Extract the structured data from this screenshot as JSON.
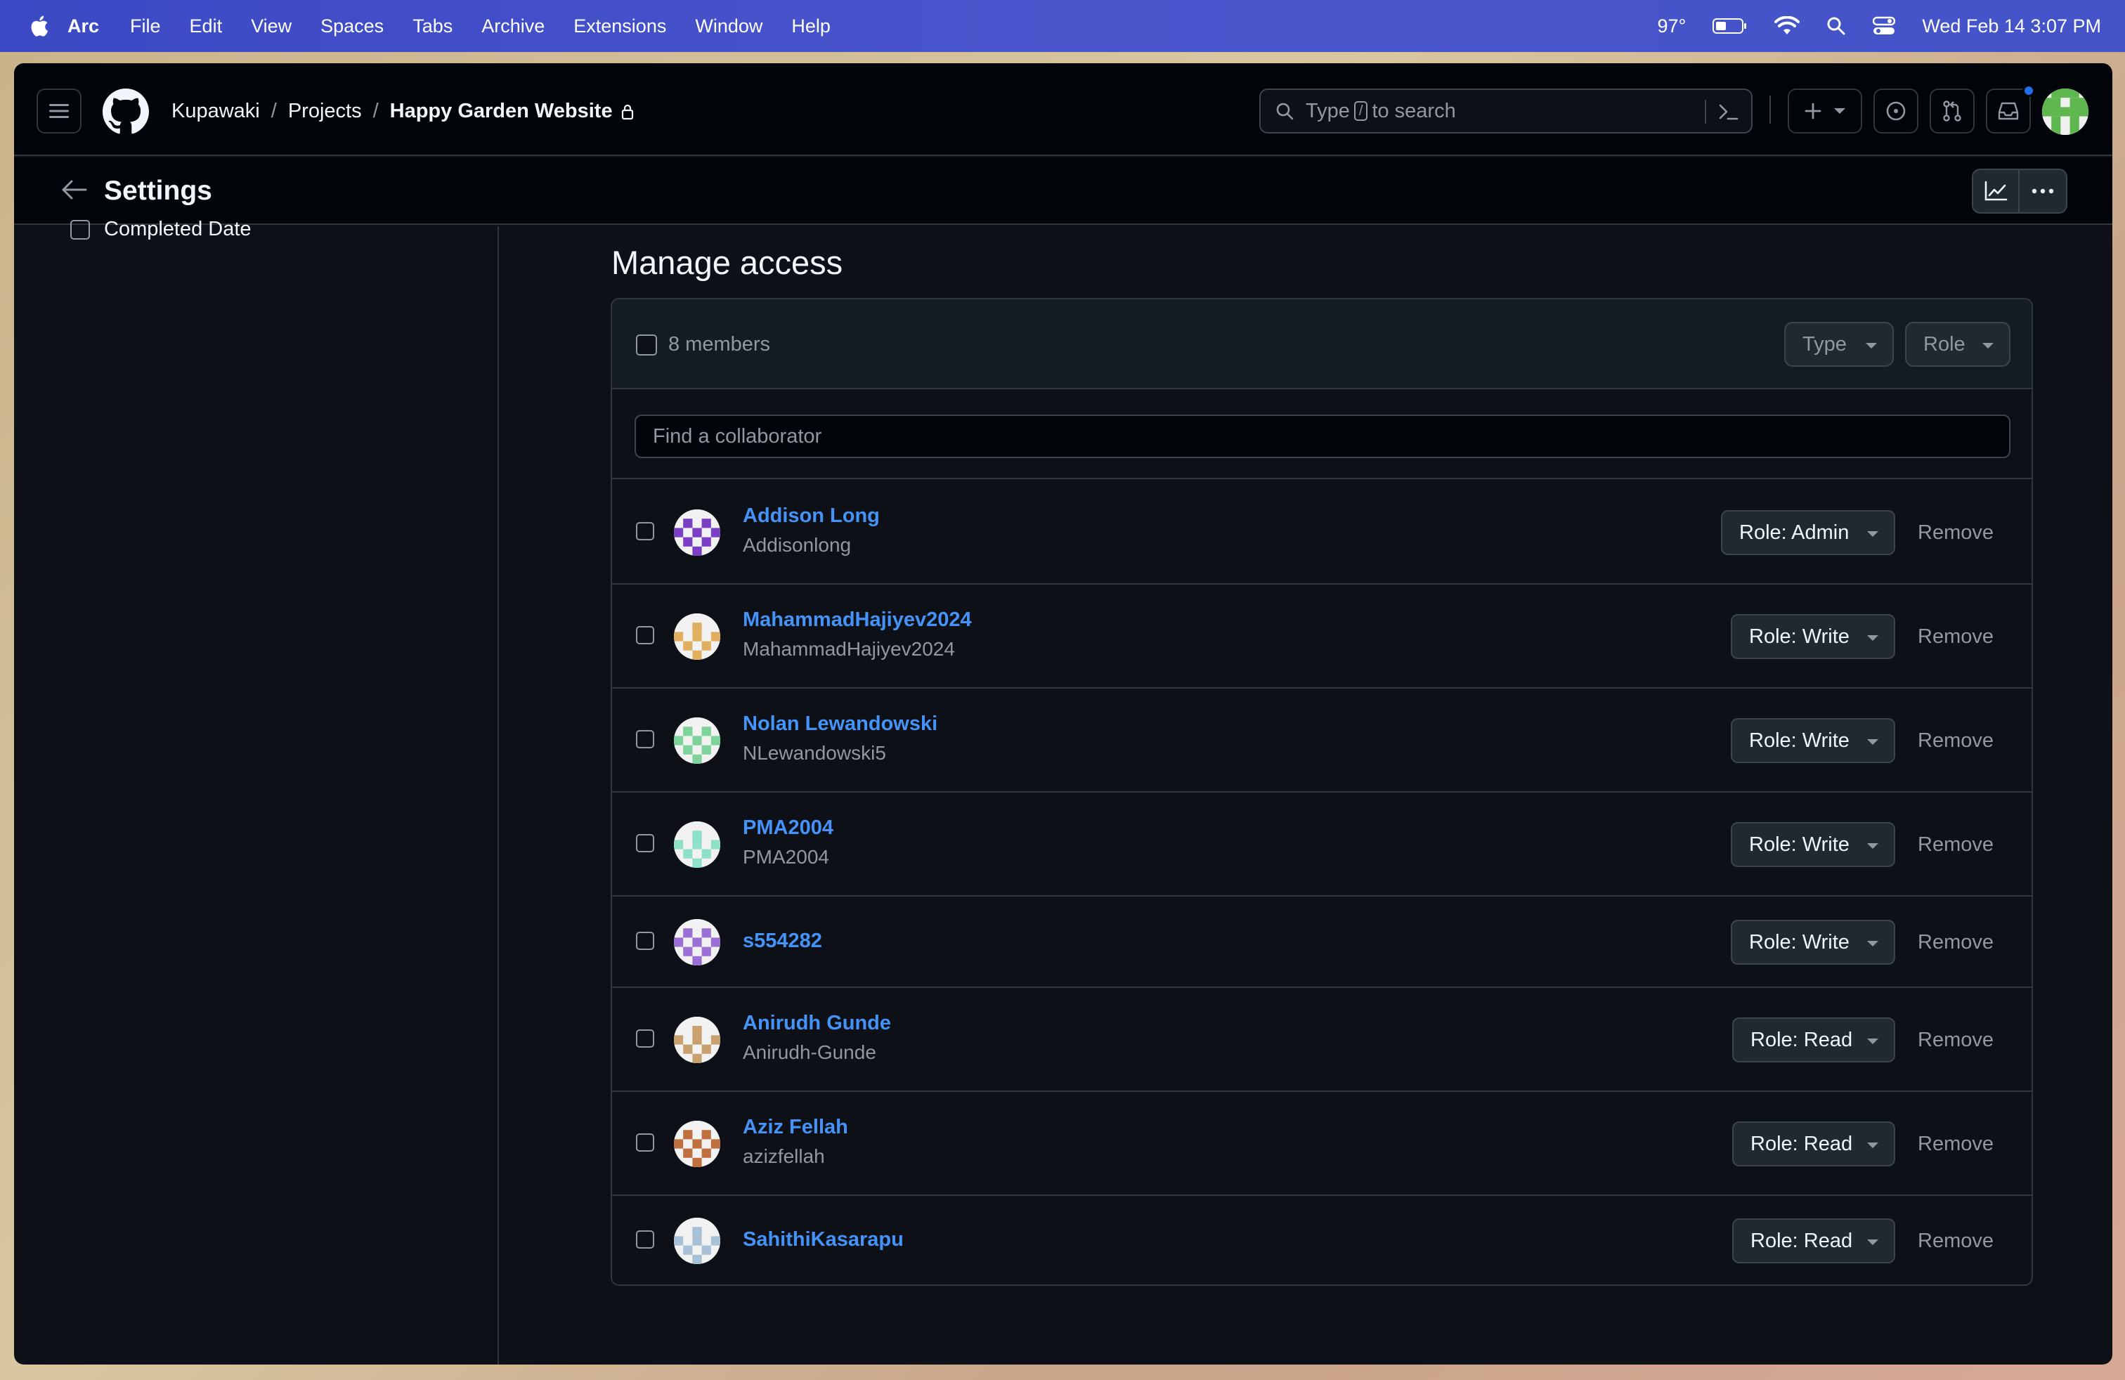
{
  "menubar": {
    "items": [
      "Arc",
      "File",
      "Edit",
      "View",
      "Spaces",
      "Tabs",
      "Archive",
      "Extensions",
      "Window",
      "Help"
    ],
    "temperature": "97°",
    "datetime": "Wed Feb 14  3:07 PM"
  },
  "header": {
    "breadcrumb": [
      "Kupawaki",
      "Projects",
      "Happy Garden Website"
    ],
    "search_placeholder_pre": "Type",
    "search_key": "/",
    "search_placeholder_post": "to search"
  },
  "subheader": {
    "title": "Settings"
  },
  "sidebar": {
    "cut_item": "Completed Date"
  },
  "main": {
    "title": "Manage access",
    "members_count": "8 members",
    "type_filter": "Type",
    "role_filter": "Role",
    "find_placeholder": "Find a collaborator",
    "remove_label": "Remove",
    "members": [
      {
        "name": "Addison Long",
        "login": "Addisonlong",
        "role": "Role: Admin",
        "avatar_color": "#7a3fc4"
      },
      {
        "name": "MahammadHajiyev2024",
        "login": "MahammadHajiyev2024",
        "role": "Role: Write",
        "avatar_color": "#e0b060"
      },
      {
        "name": "Nolan Lewandowski",
        "login": "NLewandowski5",
        "role": "Role: Write",
        "avatar_color": "#7ed39a"
      },
      {
        "name": "PMA2004",
        "login": "PMA2004",
        "role": "Role: Write",
        "avatar_color": "#8fe0c8"
      },
      {
        "name": "s554282",
        "login": "",
        "role": "Role: Write",
        "avatar_color": "#9a6fd6"
      },
      {
        "name": "Anirudh Gunde",
        "login": "Anirudh-Gunde",
        "role": "Role: Read",
        "avatar_color": "#c9a070"
      },
      {
        "name": "Aziz Fellah",
        "login": "azizfellah",
        "role": "Role: Read",
        "avatar_color": "#c07040"
      },
      {
        "name": "SahithiKasarapu",
        "login": "",
        "role": "Role: Read",
        "avatar_color": "#a8c0d8"
      }
    ]
  }
}
